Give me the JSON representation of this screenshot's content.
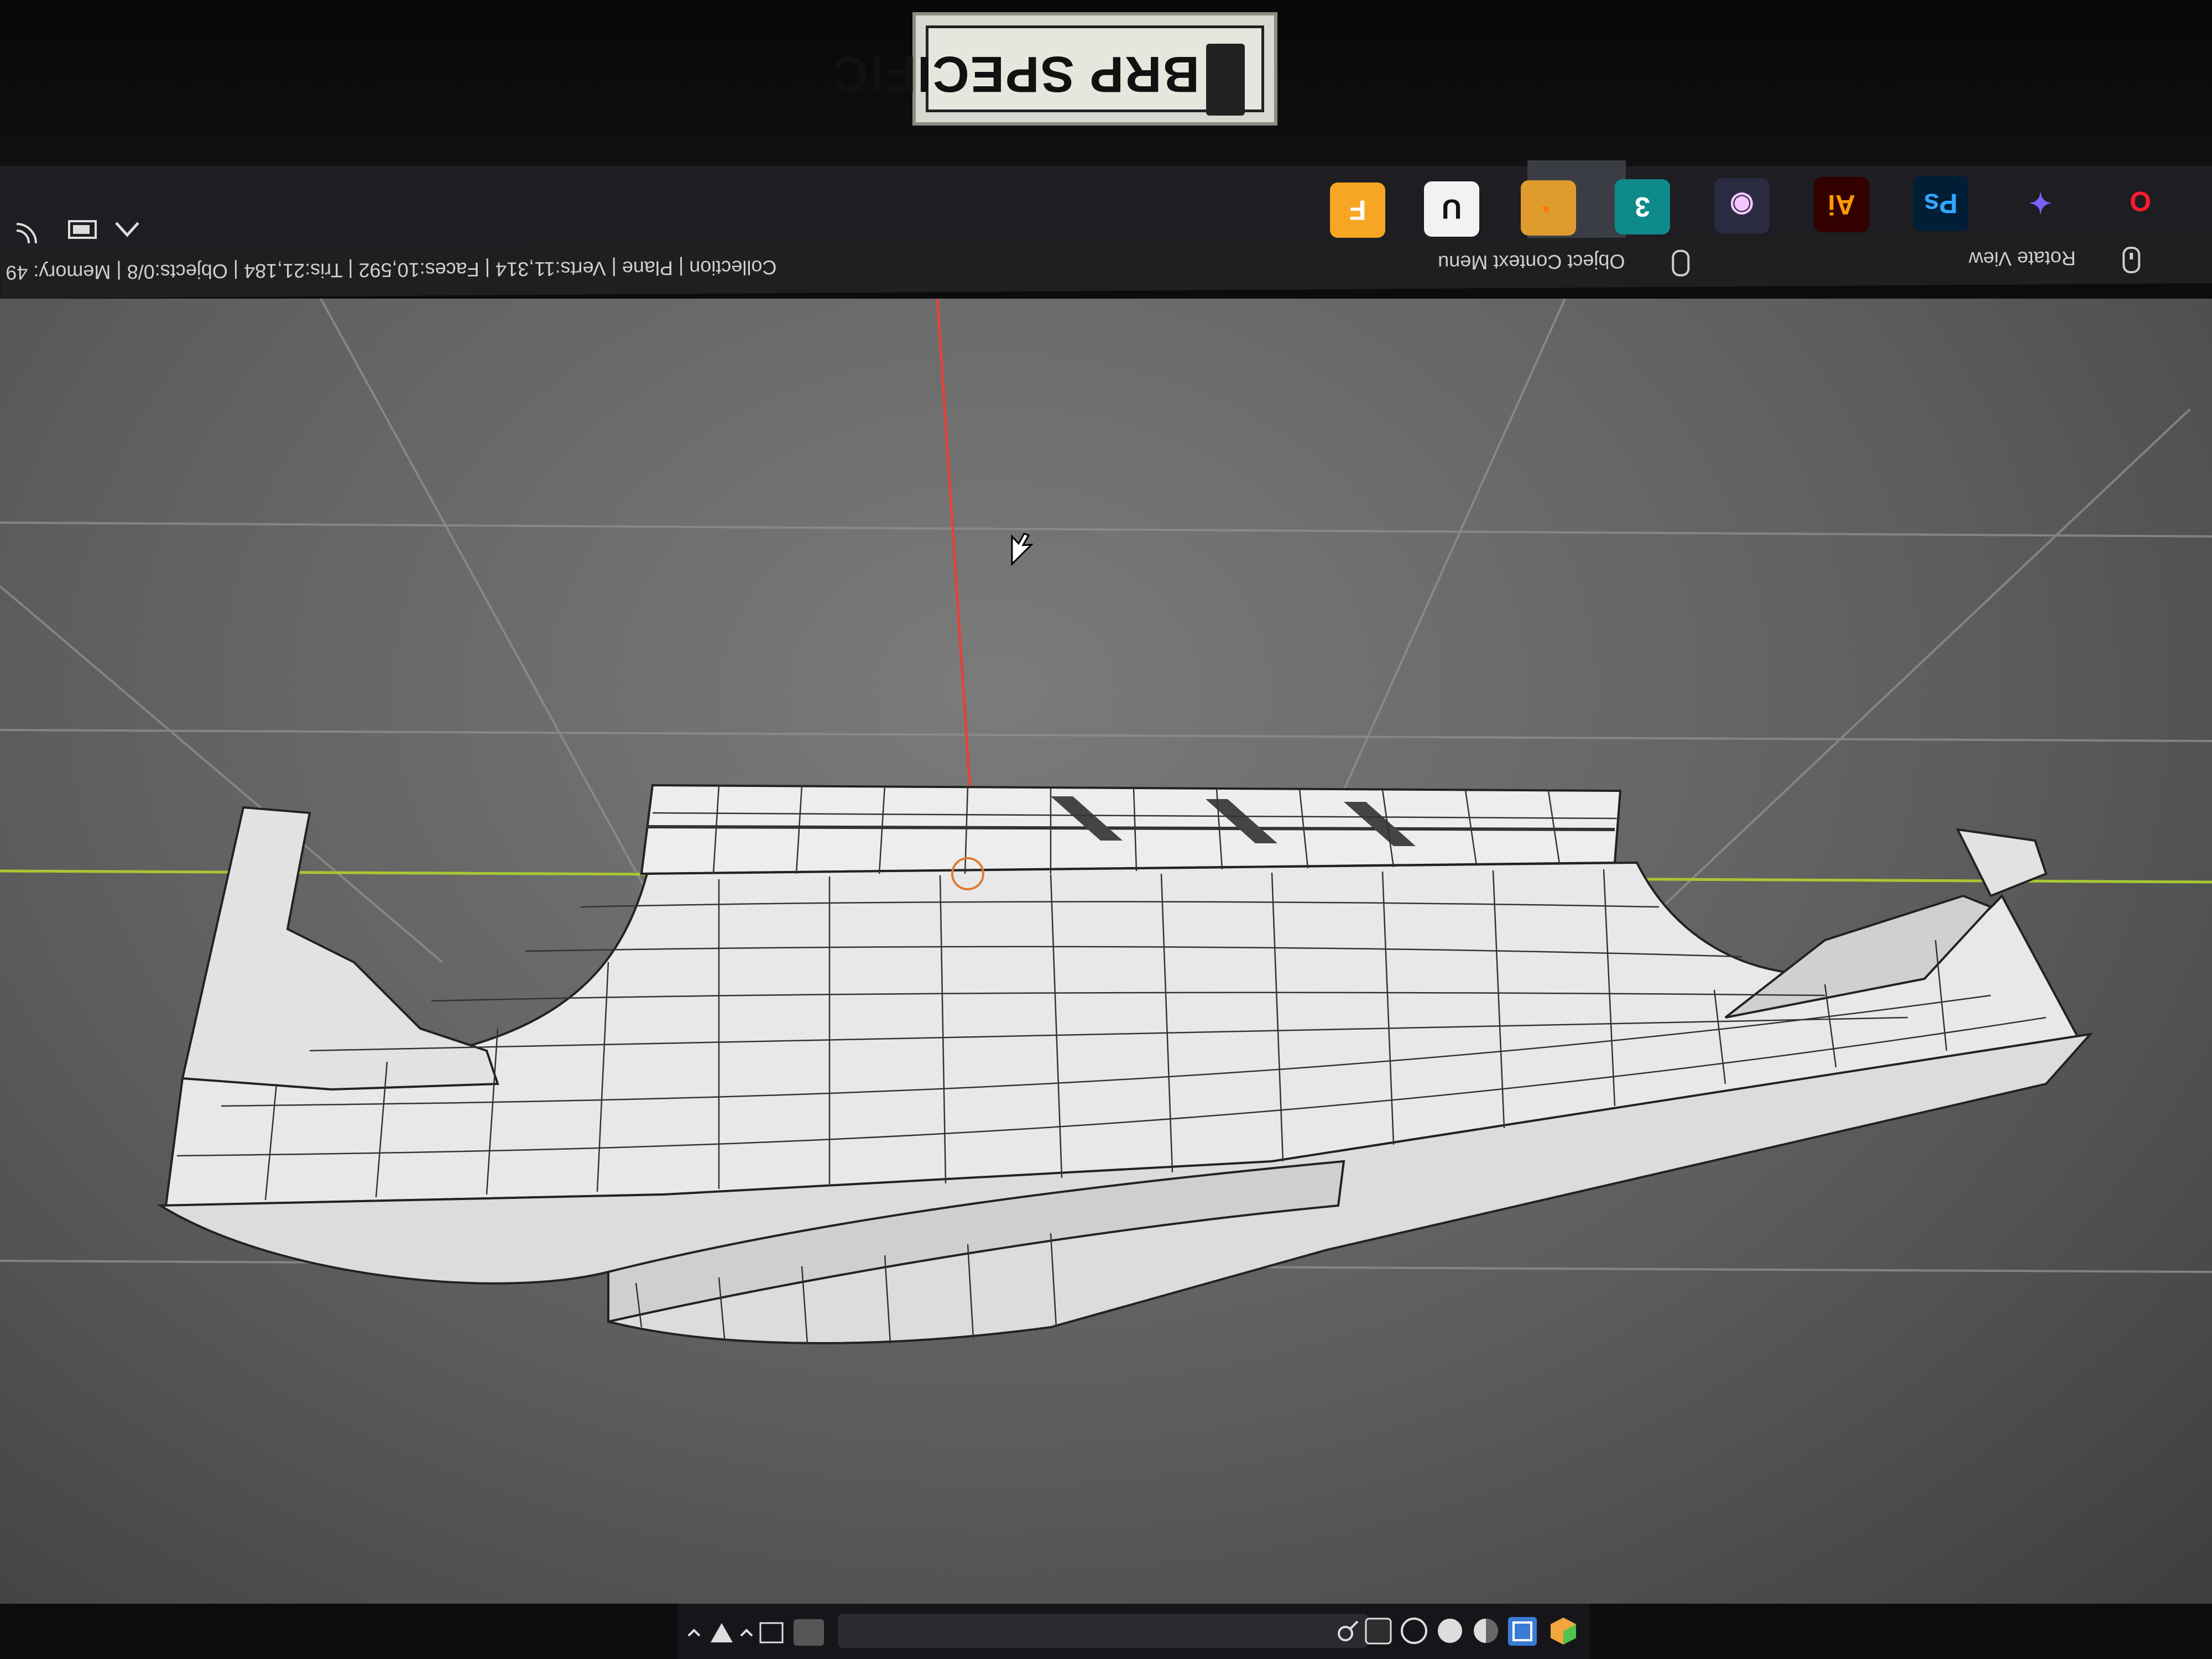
{
  "sticker": {
    "text": "BRP SPECIFIC"
  },
  "taskbar": {
    "apps": [
      {
        "name": "opera-icon",
        "glyph": "O",
        "color": "#ff1b2d",
        "bg": "transparent"
      },
      {
        "name": "figma-icon",
        "glyph": "✦",
        "color": "#7b61ff",
        "bg": "transparent"
      },
      {
        "name": "photoshop-icon",
        "glyph": "Ps",
        "color": "#31a8ff",
        "bg": "#001e36"
      },
      {
        "name": "illustrator-icon",
        "glyph": "Ai",
        "color": "#ff9a00",
        "bg": "#330000"
      },
      {
        "name": "davinci-resolve-icon",
        "glyph": "◉",
        "color": "#f5c6ff",
        "bg": "#2a2a40"
      },
      {
        "name": "3ds-max-icon",
        "glyph": "3",
        "color": "#ffffff",
        "bg": "#0f8a8a"
      },
      {
        "name": "blender-icon",
        "glyph": "◔",
        "color": "#ff7a00",
        "bg": "#e09b2f"
      },
      {
        "name": "unreal-engine-icon",
        "glyph": "U",
        "color": "#111111",
        "bg": "#f2f2f2"
      },
      {
        "name": "fusion-360-icon",
        "glyph": "F",
        "color": "#ffffff",
        "bg": "#f6a623"
      }
    ]
  },
  "statusbar": {
    "stats": "Collection | Plane | Verts:11,314 | Faces:10,592 | Tris:21,184 | Objects:0/8 | Memory: 49",
    "hint_context_menu": "Object Context Menu",
    "hint_rotate": "Rotate View"
  },
  "colors": {
    "viewport": "#6a6a6a",
    "x_axis": "#e0453a",
    "y_axis": "#a8c832",
    "mesh": "#e9e9e9",
    "wire": "#222222"
  }
}
